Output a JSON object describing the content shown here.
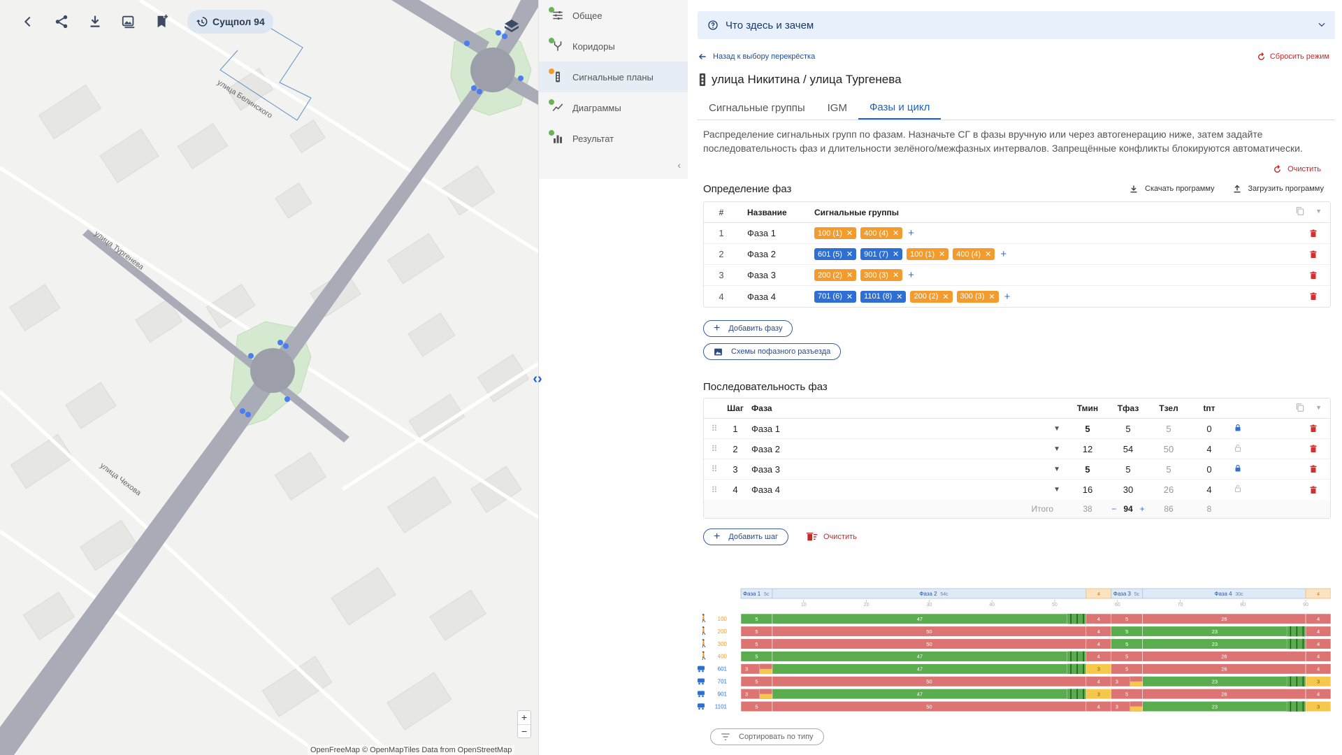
{
  "map": {
    "toolbar": {
      "plan_label": "Сущпол 94"
    },
    "streets": {
      "belinsky": "улица Белинского",
      "turgenev": "улица Тургенева",
      "chekhov": "улица Чехова"
    },
    "zoom_in": "+",
    "zoom_out": "−",
    "attribution": "OpenFreeMap © OpenMapTiles Data from OpenStreetMap"
  },
  "sidebar": {
    "items": [
      {
        "label": "Общее",
        "dot": "#6bb35a"
      },
      {
        "label": "Коридоры",
        "dot": "#6bb35a"
      },
      {
        "label": "Сигнальные планы",
        "dot": "#f39b2d"
      },
      {
        "label": "Диаграммы",
        "dot": "#6bb35a"
      },
      {
        "label": "Результат",
        "dot": "#6bb35a"
      }
    ],
    "collapse": "‹",
    "split_handle": "‹›"
  },
  "main": {
    "info_bar": "Что здесь и зачем",
    "back_link": "Назад к выбору перекрёстка",
    "reset_link": "Сбросить режим",
    "crossing_title": "улица Никитина / улица Тургенева",
    "tabs": [
      "Сигнальные группы",
      "IGM",
      "Фазы и цикл"
    ],
    "description": "Распределение сигнальных групп по фазам. Назначьте СГ в фазы вручную или через автогенерацию ниже, затем задайте последовательность фаз и длительности зелёного/межфазных интервалов. Запрещённые конфликты блокируются автоматически.",
    "clear_label": "Очистить",
    "phases_section": {
      "title": "Определение фаз",
      "download": "Скачать программу",
      "upload": "Загрузить программу",
      "headers": [
        "#",
        "Название",
        "Сигнальные группы"
      ],
      "rows": [
        {
          "num": "1",
          "name": "Фаза 1",
          "groups": [
            {
              "label": "100 (1)",
              "type": "orange"
            },
            {
              "label": "400 (4)",
              "type": "orange"
            }
          ]
        },
        {
          "num": "2",
          "name": "Фаза 2",
          "groups": [
            {
              "label": "601 (5)",
              "type": "blue"
            },
            {
              "label": "901 (7)",
              "type": "blue"
            },
            {
              "label": "100 (1)",
              "type": "orange"
            },
            {
              "label": "400 (4)",
              "type": "orange"
            }
          ]
        },
        {
          "num": "3",
          "name": "Фаза 3",
          "groups": [
            {
              "label": "200 (2)",
              "type": "orange"
            },
            {
              "label": "300 (3)",
              "type": "orange"
            }
          ]
        },
        {
          "num": "4",
          "name": "Фаза 4",
          "groups": [
            {
              "label": "701 (6)",
              "type": "blue"
            },
            {
              "label": "1101 (8)",
              "type": "blue"
            },
            {
              "label": "200 (2)",
              "type": "orange"
            },
            {
              "label": "300 (3)",
              "type": "orange"
            }
          ]
        }
      ],
      "add_phase": "Добавить фазу",
      "schemes": "Схемы пофазного разъезда"
    },
    "sequence_section": {
      "title": "Последовательность фаз",
      "headers": [
        "Шаг",
        "Фаза",
        "Тмин",
        "Тфаз",
        "Тзел",
        "tпт"
      ],
      "rows": [
        {
          "step": "1",
          "phase": "Фаза 1",
          "tmin": "5",
          "tphase": "5",
          "tgreen": "5",
          "tpt": "0",
          "locked": true
        },
        {
          "step": "2",
          "phase": "Фаза 2",
          "tmin": "12",
          "tphase": "54",
          "tgreen": "50",
          "tpt": "4",
          "locked": false
        },
        {
          "step": "3",
          "phase": "Фаза 3",
          "tmin": "5",
          "tphase": "5",
          "tgreen": "5",
          "tpt": "0",
          "locked": true
        },
        {
          "step": "4",
          "phase": "Фаза 4",
          "tmin": "16",
          "tphase": "30",
          "tgreen": "26",
          "tpt": "4",
          "locked": false
        }
      ],
      "total_label": "Итого",
      "total_tmin": "38",
      "total_cycle": "94",
      "total_tgreen": "86",
      "total_tpt": "8",
      "add_step": "Добавить шаг",
      "clear": "Очистить"
    },
    "sort_button": "Сортировать по типу"
  },
  "chart_data": {
    "type": "gantt",
    "cycle": 94,
    "phases": [
      {
        "label": "Фаза 1",
        "dur": "5с",
        "start": 0,
        "end": 5,
        "inter": null
      },
      {
        "label": "Фаза 2",
        "dur": "54с",
        "start": 5,
        "end": 55,
        "inter": "4"
      },
      {
        "label": "Фаза 3",
        "dur": "5с",
        "start": 59,
        "end": 64,
        "inter": null
      },
      {
        "label": "Фаза 4",
        "dur": "30с",
        "start": 64,
        "end": 90,
        "inter": "4"
      }
    ],
    "ticks": [
      10,
      20,
      30,
      40,
      50,
      60,
      70,
      80,
      90
    ],
    "colors": {
      "green": "#5aac4e",
      "red": "#dc7474",
      "yellow": "#f5c84c",
      "orange": "#f39b2d",
      "ped": "#f39b2d",
      "veh": "#2d6fd2"
    },
    "groups": [
      {
        "name": "100",
        "kind": "ped",
        "segments": [
          {
            "c": "green",
            "s": 0,
            "e": 5,
            "t": "5"
          },
          {
            "c": "green",
            "s": 5,
            "e": 52,
            "t": "47"
          },
          {
            "c": "flash",
            "s": 52,
            "e": 55
          },
          {
            "c": "red",
            "s": 55,
            "e": 59,
            "t": "4"
          },
          {
            "c": "red",
            "s": 59,
            "e": 64,
            "t": "5"
          },
          {
            "c": "red",
            "s": 64,
            "e": 90,
            "t": "26"
          },
          {
            "c": "red",
            "s": 90,
            "e": 94,
            "t": "4"
          }
        ]
      },
      {
        "name": "200",
        "kind": "ped",
        "segments": [
          {
            "c": "red",
            "s": 0,
            "e": 5,
            "t": "5"
          },
          {
            "c": "red",
            "s": 5,
            "e": 55,
            "t": "50"
          },
          {
            "c": "red",
            "s": 55,
            "e": 59,
            "t": "4"
          },
          {
            "c": "green",
            "s": 59,
            "e": 64,
            "t": "5"
          },
          {
            "c": "green",
            "s": 64,
            "e": 87,
            "t": "23"
          },
          {
            "c": "flash",
            "s": 87,
            "e": 90
          },
          {
            "c": "red",
            "s": 90,
            "e": 94,
            "t": "4"
          }
        ]
      },
      {
        "name": "300",
        "kind": "ped",
        "segments": [
          {
            "c": "red",
            "s": 0,
            "e": 5,
            "t": "5"
          },
          {
            "c": "red",
            "s": 5,
            "e": 55,
            "t": "50"
          },
          {
            "c": "red",
            "s": 55,
            "e": 59,
            "t": "4"
          },
          {
            "c": "green",
            "s": 59,
            "e": 64,
            "t": "5"
          },
          {
            "c": "green",
            "s": 64,
            "e": 87,
            "t": "23"
          },
          {
            "c": "flash",
            "s": 87,
            "e": 90
          },
          {
            "c": "red",
            "s": 90,
            "e": 94,
            "t": "4"
          }
        ]
      },
      {
        "name": "400",
        "kind": "ped",
        "segments": [
          {
            "c": "green",
            "s": 0,
            "e": 5,
            "t": "5"
          },
          {
            "c": "green",
            "s": 5,
            "e": 52,
            "t": "47"
          },
          {
            "c": "flash",
            "s": 52,
            "e": 55
          },
          {
            "c": "red",
            "s": 55,
            "e": 59,
            "t": "4"
          },
          {
            "c": "red",
            "s": 59,
            "e": 64,
            "t": "5"
          },
          {
            "c": "red",
            "s": 64,
            "e": 90,
            "t": "26"
          },
          {
            "c": "red",
            "s": 90,
            "e": 94,
            "t": "4"
          }
        ]
      },
      {
        "name": "601",
        "kind": "veh",
        "segments": [
          {
            "c": "red",
            "s": 0,
            "e": 3,
            "t": "3"
          },
          {
            "c": "redyellow",
            "s": 3,
            "e": 5
          },
          {
            "c": "green",
            "s": 5,
            "e": 52,
            "t": "47"
          },
          {
            "c": "flash",
            "s": 52,
            "e": 55
          },
          {
            "c": "yellow",
            "s": 55,
            "e": 59,
            "t": "3"
          },
          {
            "c": "red",
            "s": 59,
            "e": 64,
            "t": "5"
          },
          {
            "c": "red",
            "s": 64,
            "e": 90,
            "t": "26"
          },
          {
            "c": "red",
            "s": 90,
            "e": 94,
            "t": "4"
          }
        ]
      },
      {
        "name": "701",
        "kind": "veh",
        "segments": [
          {
            "c": "red",
            "s": 0,
            "e": 5,
            "t": "5"
          },
          {
            "c": "red",
            "s": 5,
            "e": 55,
            "t": "50"
          },
          {
            "c": "red",
            "s": 55,
            "e": 59,
            "t": "4"
          },
          {
            "c": "red",
            "s": 59,
            "e": 62,
            "t": "3"
          },
          {
            "c": "redyellow",
            "s": 62,
            "e": 64
          },
          {
            "c": "green",
            "s": 64,
            "e": 87,
            "t": "23"
          },
          {
            "c": "flash",
            "s": 87,
            "e": 90
          },
          {
            "c": "yellow",
            "s": 90,
            "e": 94,
            "t": "3"
          }
        ]
      },
      {
        "name": "901",
        "kind": "veh",
        "segments": [
          {
            "c": "red",
            "s": 0,
            "e": 3,
            "t": "3"
          },
          {
            "c": "redyellow",
            "s": 3,
            "e": 5
          },
          {
            "c": "green",
            "s": 5,
            "e": 52,
            "t": "47"
          },
          {
            "c": "flash",
            "s": 52,
            "e": 55
          },
          {
            "c": "yellow",
            "s": 55,
            "e": 59,
            "t": "3"
          },
          {
            "c": "red",
            "s": 59,
            "e": 64,
            "t": "5"
          },
          {
            "c": "red",
            "s": 64,
            "e": 90,
            "t": "26"
          },
          {
            "c": "red",
            "s": 90,
            "e": 94,
            "t": "4"
          }
        ]
      },
      {
        "name": "1101",
        "kind": "veh",
        "segments": [
          {
            "c": "red",
            "s": 0,
            "e": 5,
            "t": "5"
          },
          {
            "c": "red",
            "s": 5,
            "e": 55,
            "t": "50"
          },
          {
            "c": "red",
            "s": 55,
            "e": 59,
            "t": "4"
          },
          {
            "c": "red",
            "s": 59,
            "e": 62,
            "t": "3"
          },
          {
            "c": "redyellow",
            "s": 62,
            "e": 64
          },
          {
            "c": "green",
            "s": 64,
            "e": 87,
            "t": "23"
          },
          {
            "c": "flash",
            "s": 87,
            "e": 90
          },
          {
            "c": "yellow",
            "s": 90,
            "e": 94,
            "t": "3"
          }
        ]
      }
    ]
  }
}
